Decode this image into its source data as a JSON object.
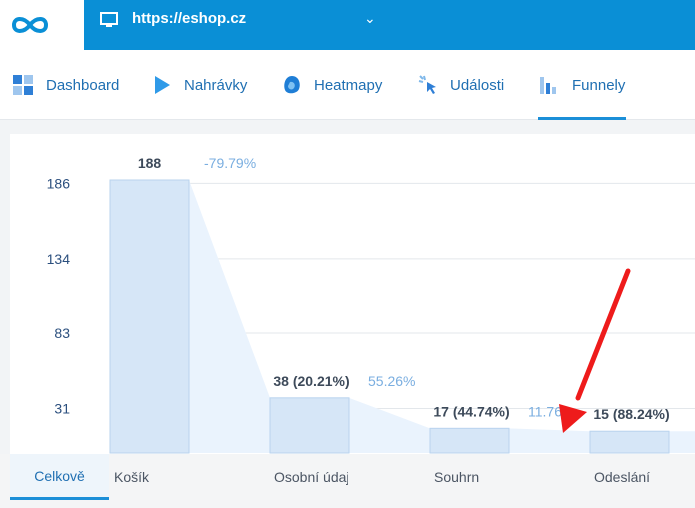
{
  "site": {
    "url": "https://eshop.cz"
  },
  "nav": {
    "items": [
      {
        "label": "Dashboard",
        "icon": "dashboard-icon"
      },
      {
        "label": "Nahrávky",
        "icon": "play-icon"
      },
      {
        "label": "Heatmapy",
        "icon": "heatmap-icon"
      },
      {
        "label": "Události",
        "icon": "cursor-click-icon"
      },
      {
        "label": "Funnely",
        "icon": "funnel-bars-icon",
        "active": true
      }
    ]
  },
  "colors": {
    "brand": "#0a8fd6",
    "bar": "#d6e6f7",
    "funnel": "#eaf3fd",
    "text": "#1f6fb2",
    "annotation_arrow": "#ee1b1b"
  },
  "chart_data": {
    "type": "bar",
    "categories": [
      "Košík",
      "Osobní údaje",
      "Souhrn",
      "Odeslání"
    ],
    "values": [
      188,
      38,
      17,
      15
    ],
    "value_labels": [
      "188",
      "38 (20.21%)",
      "17 (44.74%)",
      "15 (88.24%)"
    ],
    "dropoff_labels": [
      "-79.79%",
      "55.26%",
      "11.76",
      ""
    ],
    "yticks": [
      "186",
      "134",
      "83",
      "31"
    ],
    "ytick_values": [
      186,
      134,
      83,
      31
    ],
    "ylim": [
      0,
      200
    ],
    "grid": true
  },
  "tabs": {
    "overall": "Celkově"
  }
}
